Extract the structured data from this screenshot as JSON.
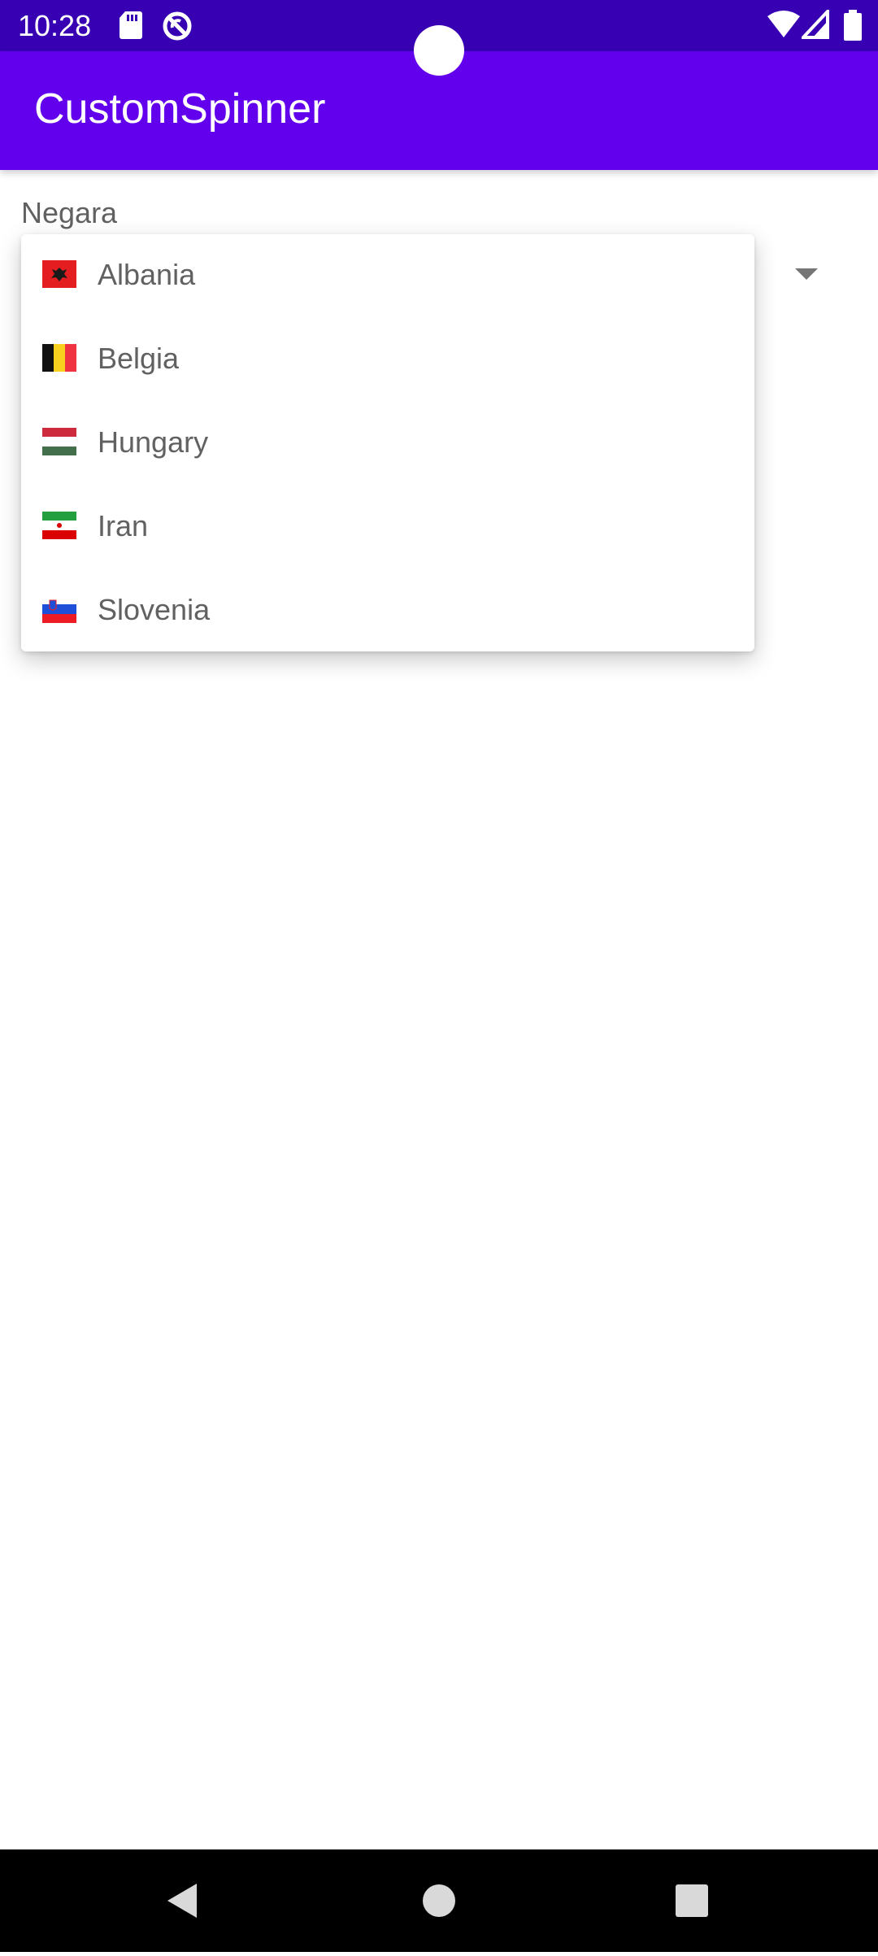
{
  "status_bar": {
    "time": "10:28",
    "icons": [
      "sd-card-icon",
      "no-sync-icon",
      "wifi-icon",
      "cellular-icon",
      "battery-icon"
    ]
  },
  "app_bar": {
    "title": "CustomSpinner"
  },
  "form": {
    "label": "Negara"
  },
  "dropdown": {
    "items": [
      {
        "label": "Albania",
        "flag": "albania-flag-icon"
      },
      {
        "label": "Belgia",
        "flag": "belgium-flag-icon"
      },
      {
        "label": "Hungary",
        "flag": "hungary-flag-icon"
      },
      {
        "label": "Iran",
        "flag": "iran-flag-icon"
      },
      {
        "label": "Slovenia",
        "flag": "slovenia-flag-icon"
      }
    ]
  },
  "nav_bar": {
    "buttons": [
      "back-icon",
      "home-icon",
      "recents-icon"
    ]
  },
  "colors": {
    "status_bar": "#3700b3",
    "app_bar": "#6200ee",
    "text_secondary": "#616161"
  }
}
